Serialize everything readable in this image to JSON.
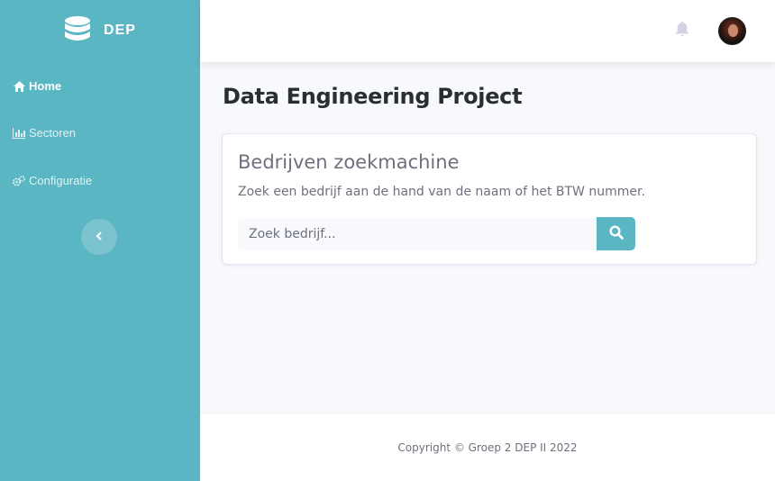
{
  "brand": {
    "name": "DEP",
    "icon": "database-icon"
  },
  "sidebar": {
    "items": [
      {
        "label": "Home",
        "icon": "home-icon",
        "active": true
      },
      {
        "label": "Sectoren",
        "icon": "bar-chart-icon",
        "active": false
      },
      {
        "label": "Configuratie",
        "icon": "cogs-icon",
        "active": false
      }
    ],
    "toggle_icon": "chevron-left-icon"
  },
  "topbar": {
    "notification_icon": "bell-icon",
    "avatar_icon": "user-avatar"
  },
  "main": {
    "page_title": "Data Engineering Project",
    "card": {
      "title": "Bedrijven zoekmachine",
      "description": "Zoek een bedrijf aan de hand van de naam of het BTW nummer.",
      "search_placeholder": "Zoek bedrijf...",
      "search_value": "",
      "search_button_icon": "search-icon"
    }
  },
  "footer": {
    "text": "Copyright © Groep 2 DEP II 2022"
  },
  "colors": {
    "primary": "#5ab6c3",
    "background": "#f8f9fc",
    "text_muted": "#6e707e",
    "title_dark": "#2b2d35"
  }
}
